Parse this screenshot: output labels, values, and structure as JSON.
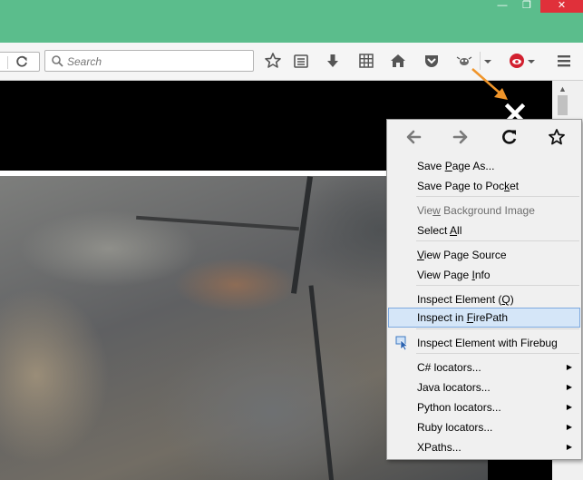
{
  "window": {
    "minimize_glyph": "—",
    "maximize_glyph": "❐",
    "close_glyph": "✕"
  },
  "toolbar": {
    "search_placeholder": "Search",
    "icons": [
      "reload-icon",
      "bookmark-star-icon",
      "reading-list-icon",
      "download-icon",
      "grid-icon",
      "home-icon",
      "pocket-icon",
      "firebug-icon",
      "dropdown-icon",
      "firepath-icon",
      "dropdown-icon",
      "hamburger-menu-icon"
    ]
  },
  "context_menu": {
    "nav_icons": [
      "back-icon",
      "forward-icon",
      "reload-icon",
      "bookmark-icon"
    ],
    "items": [
      {
        "pre": "Save ",
        "acc": "P",
        "post": "age As...",
        "enabled": true
      },
      {
        "pre": "Save Page to Poc",
        "acc": "k",
        "post": "et",
        "enabled": true
      },
      {
        "pre": "Vie",
        "acc": "w",
        "post": " Background Image",
        "enabled": false
      },
      {
        "pre": "Select ",
        "acc": "A",
        "post": "ll",
        "enabled": true
      },
      {
        "pre": "",
        "acc": "V",
        "post": "iew Page Source",
        "enabled": true
      },
      {
        "pre": "View Page ",
        "acc": "I",
        "post": "nfo",
        "enabled": true
      },
      {
        "pre": "Inspect Element (",
        "acc": "Q",
        "post": ")",
        "enabled": true
      },
      {
        "pre": "Inspect in ",
        "acc": "F",
        "post": "irePath",
        "enabled": true,
        "highlighted": true
      },
      {
        "pre": "Inspect Element with Firebug",
        "acc": "",
        "post": "",
        "enabled": true
      },
      {
        "pre": "C# locators...",
        "acc": "",
        "post": "",
        "enabled": true,
        "submenu": true
      },
      {
        "pre": "Java locators...",
        "acc": "",
        "post": "",
        "enabled": true,
        "submenu": true
      },
      {
        "pre": "Python locators...",
        "acc": "",
        "post": "",
        "enabled": true,
        "submenu": true
      },
      {
        "pre": "Ruby locators...",
        "acc": "",
        "post": "",
        "enabled": true,
        "submenu": true
      },
      {
        "pre": "XPaths...",
        "acc": "",
        "post": "",
        "enabled": true,
        "submenu": true
      }
    ],
    "submenu_arrow": "▶"
  },
  "colors": {
    "titlebar": "#5bbd8c",
    "annotation_arrow": "#f0952a",
    "highlight": "#d5e6f8"
  }
}
